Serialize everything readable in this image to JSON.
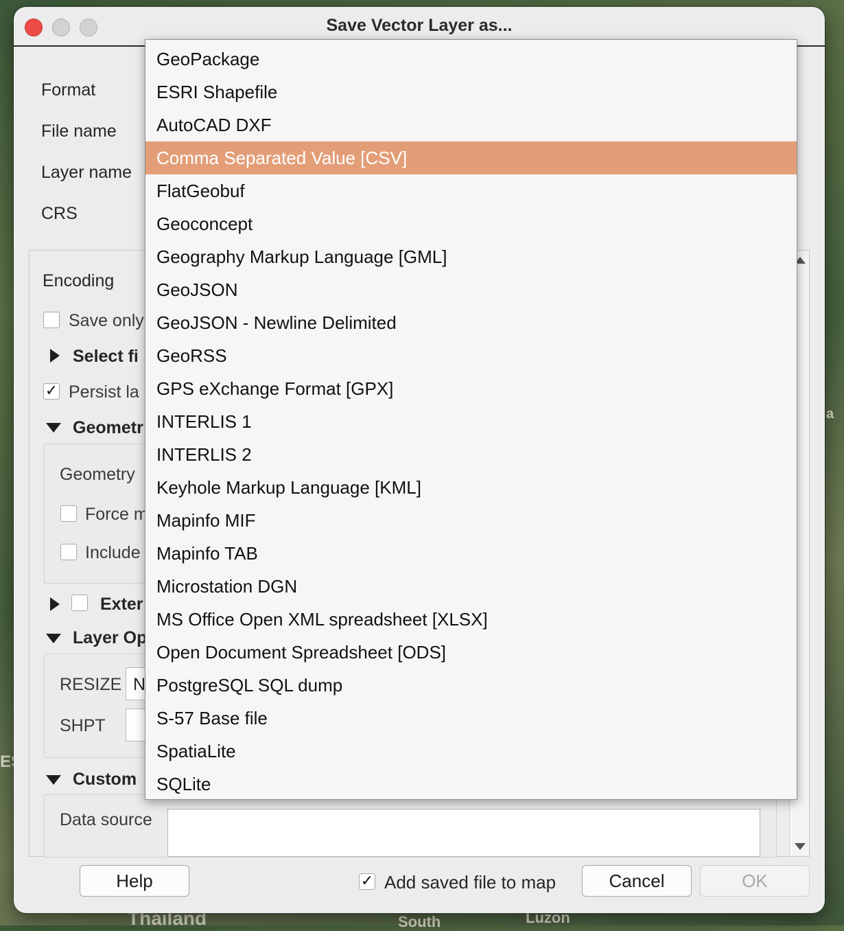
{
  "background": {
    "map_labels": [
      "Thailand",
      "South",
      "Luzon",
      "a",
      "ES"
    ]
  },
  "dialog": {
    "title": "Save Vector Layer as..."
  },
  "form": {
    "format_label": "Format",
    "file_name_label": "File name",
    "layer_name_label": "Layer name",
    "crs_label": "CRS",
    "encoding_label": "Encoding",
    "save_only_label": "Save only",
    "select_fields_label": "Select fi",
    "persist_label": "Persist la",
    "geometry_section_label": "Geometr",
    "geometry_type_label": "Geometry",
    "force_multi_label": "Force m",
    "include_z_label": "Include",
    "extent_label": "Exter",
    "layer_options_label": "Layer Op",
    "resize_label": "RESIZE",
    "resize_value": "N",
    "shpt_label": "SHPT",
    "custom_label": "Custom",
    "data_source_label": "Data source"
  },
  "format_dropdown": {
    "selected": "Comma Separated Value [CSV]",
    "items": [
      "GeoPackage",
      "ESRI Shapefile",
      "AutoCAD DXF",
      "Comma Separated Value [CSV]",
      "FlatGeobuf",
      "Geoconcept",
      "Geography Markup Language [GML]",
      "GeoJSON",
      "GeoJSON - Newline Delimited",
      "GeoRSS",
      "GPS eXchange Format [GPX]",
      "INTERLIS 1",
      "INTERLIS 2",
      "Keyhole Markup Language [KML]",
      "Mapinfo MIF",
      "Mapinfo TAB",
      "Microstation DGN",
      "MS Office Open XML spreadsheet [XLSX]",
      "Open Document Spreadsheet [ODS]",
      "PostgreSQL SQL dump",
      "S-57 Base file",
      "SpatiaLite",
      "SQLite"
    ]
  },
  "footer": {
    "help_label": "Help",
    "add_to_map_label": "Add saved file to map",
    "add_to_map_checked": true,
    "cancel_label": "Cancel",
    "ok_label": "OK"
  },
  "colors": {
    "selection": "#e39e78",
    "close_button": "#ed4c46"
  }
}
